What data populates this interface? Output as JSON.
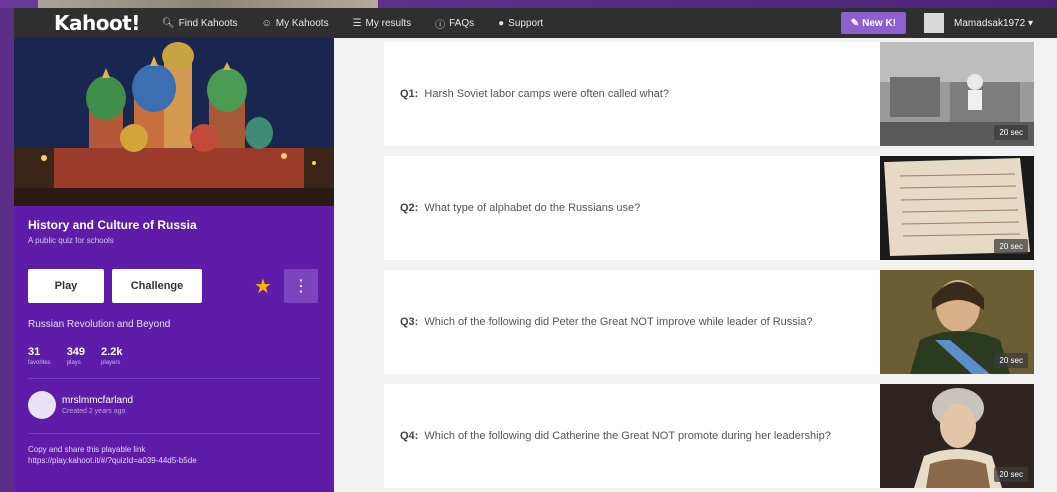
{
  "nav": {
    "logo": "Kahoot!",
    "links": [
      {
        "icon": "search-icon",
        "label": "Find Kahoots"
      },
      {
        "icon": "person-icon",
        "label": "My Kahoots"
      },
      {
        "icon": "list-icon",
        "label": "My results"
      },
      {
        "icon": "help-icon",
        "label": "FAQs"
      },
      {
        "icon": "chat-icon",
        "label": "Support"
      }
    ],
    "new_button": "New K!",
    "username": "Mamadsak1972"
  },
  "quiz": {
    "title": "History and Culture of Russia",
    "subtitle": "A public quiz for schools",
    "play_label": "Play",
    "challenge_label": "Challenge",
    "folder": "Russian Revolution and Beyond",
    "stats": [
      {
        "value": "31",
        "label": "favorites"
      },
      {
        "value": "349",
        "label": "plays"
      },
      {
        "value": "2.2k",
        "label": "players"
      }
    ],
    "creator": "mrslmmcfarland",
    "created": "Created 2 years ago",
    "share_text": "Copy and share this playable link",
    "share_link": "https://play.kahoot.it/#/?quizId=a039-44d5-b5de"
  },
  "questions": [
    {
      "number": "Q1:",
      "text": "Harsh Soviet labor camps were often called what?",
      "time": "20 sec"
    },
    {
      "number": "Q2:",
      "text": "What type of alphabet do the Russians use?",
      "time": "20 sec"
    },
    {
      "number": "Q3:",
      "text": "Which of the following did Peter the Great NOT improve while leader of Russia?",
      "time": "20 sec"
    },
    {
      "number": "Q4:",
      "text": "Which of the following did Catherine the Great NOT promote during her leadership?",
      "time": "20 sec"
    }
  ],
  "colors": {
    "panel_purple": "#5e1ca8",
    "nav_dark": "#2f2f2f",
    "accent_purple": "#8e5fd1",
    "star_gold": "#f5b400"
  }
}
